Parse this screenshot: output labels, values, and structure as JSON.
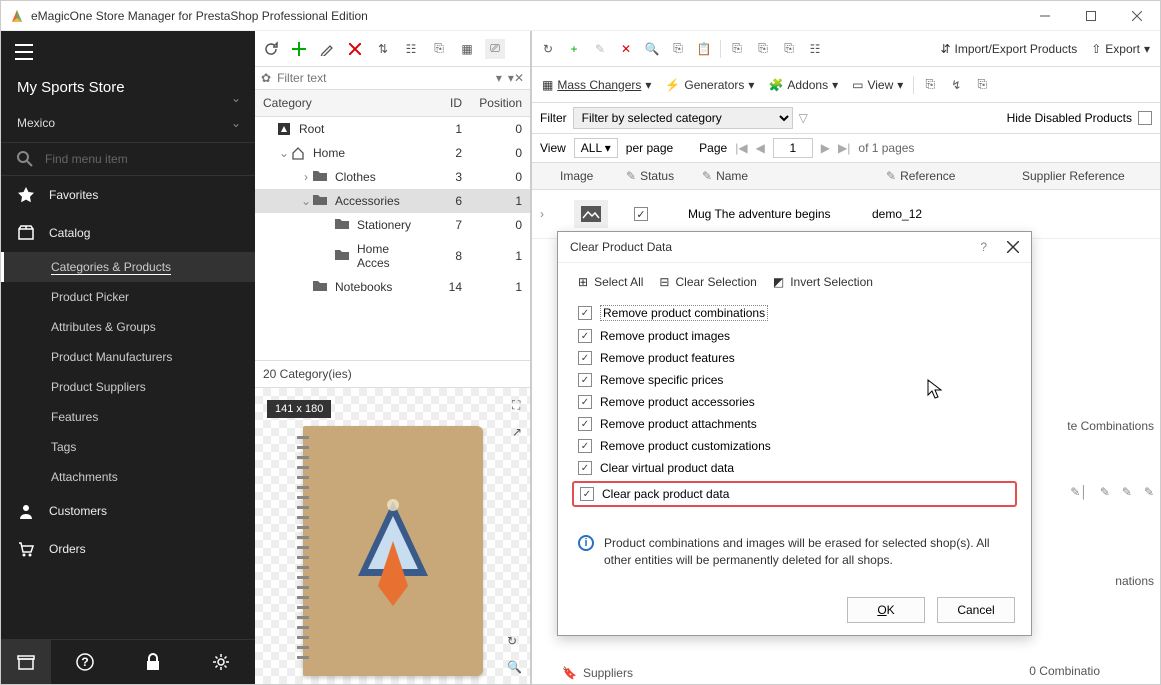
{
  "window": {
    "title": "eMagicOne Store Manager for PrestaShop Professional Edition"
  },
  "sidebar": {
    "store_name": "My Sports Store",
    "store_sub": "",
    "locale": "Mexico",
    "search_placeholder": "Find menu item",
    "favorites": "Favorites",
    "catalog": "Catalog",
    "submenu": {
      "categories_products": "Categories & Products",
      "product_picker": "Product Picker",
      "attributes_groups": "Attributes & Groups",
      "product_manufacturers": "Product Manufacturers",
      "product_suppliers": "Product Suppliers",
      "features": "Features",
      "tags": "Tags",
      "attachments": "Attachments"
    },
    "customers": "Customers",
    "orders": "Orders"
  },
  "categories": {
    "filter_placeholder": "Filter text",
    "header": {
      "name": "Category",
      "id": "ID",
      "pos": "Position"
    },
    "rows": [
      {
        "name": "Root",
        "id": "1",
        "pos": "0",
        "indent": 0,
        "twist": "",
        "icon": "root"
      },
      {
        "name": "Home",
        "id": "2",
        "pos": "0",
        "indent": 1,
        "twist": "v",
        "icon": "home"
      },
      {
        "name": "Clothes",
        "id": "3",
        "pos": "0",
        "indent": 2,
        "twist": ">",
        "icon": "folder"
      },
      {
        "name": "Accessories",
        "id": "6",
        "pos": "1",
        "indent": 2,
        "twist": "v",
        "icon": "folder",
        "selected": true
      },
      {
        "name": "Stationery",
        "id": "7",
        "pos": "0",
        "indent": 3,
        "twist": "",
        "icon": "folder"
      },
      {
        "name": "Home Acces",
        "id": "8",
        "pos": "1",
        "indent": 3,
        "twist": "",
        "icon": "folder"
      },
      {
        "name": "Notebooks",
        "id": "14",
        "pos": "1",
        "indent": 2,
        "twist": "",
        "icon": "folder"
      }
    ],
    "footer": "20 Category(ies)"
  },
  "preview": {
    "size": "141 x 180"
  },
  "products": {
    "toolbar": {
      "mass_changers": "Mass Changers",
      "generators": "Generators",
      "addons": "Addons",
      "view": "View",
      "import_export": "Import/Export Products",
      "export": "Export"
    },
    "filter": {
      "label": "Filter",
      "value": "Filter by selected category",
      "hide_disabled": "Hide Disabled Products"
    },
    "view_line": {
      "view": "View",
      "all": "ALL",
      "per_page": "per page",
      "page": "Page",
      "page_val": "1",
      "of_pages": "of 1 pages"
    },
    "header": {
      "image": "Image",
      "status": "Status",
      "name": "Name",
      "reference": "Reference",
      "supplier_reference": "Supplier Reference"
    },
    "row": {
      "name": "Mug The adventure begins",
      "reference": "demo_12"
    },
    "edge1": "te Combinations",
    "edge2": "nations",
    "edge3": "0 Combinatio",
    "suppliers": "Suppliers"
  },
  "dialog": {
    "title": "Clear Product Data",
    "select_all": "Select All",
    "clear_selection": "Clear Selection",
    "invert_selection": "Invert Selection",
    "options": [
      "Remove product combinations",
      "Remove product images",
      "Remove product features",
      "Remove specific prices",
      "Remove product accessories",
      "Remove product attachments",
      "Remove product customizations",
      "Clear virtual product data",
      "Clear pack product data"
    ],
    "info": "Product combinations and images will be erased for selected shop(s). All other entities will be permanently deleted for all shops.",
    "ok": "OK",
    "cancel": "Cancel"
  }
}
